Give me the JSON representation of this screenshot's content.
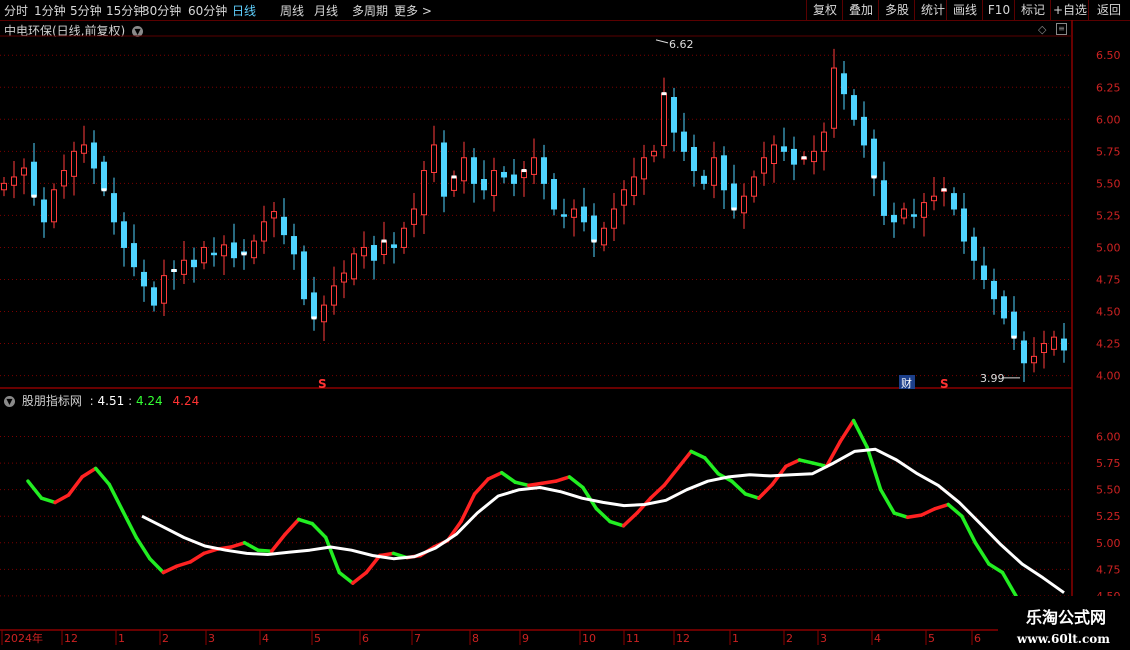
{
  "toolbar": {
    "left_items": [
      "分时",
      "1分钟",
      "5分钟",
      "15分钟",
      "30分钟",
      "60分钟",
      "日线",
      "周线",
      "月线",
      "多周期",
      "更多 >"
    ],
    "active": "日线",
    "right_items": [
      "复权",
      "叠加",
      "多股",
      "统计",
      "画线",
      "F10",
      "标记",
      "+自选",
      "返回"
    ]
  },
  "main_panel": {
    "title": "中电环保(日线,前复权)",
    "high_label": "6.62",
    "low_label": "3.99",
    "event_marks": [
      "S",
      "S"
    ],
    "caibao_mark": "财",
    "price_axis": [
      "6.50",
      "6.25",
      "6.00",
      "5.75",
      "5.50",
      "5.25",
      "5.00",
      "4.75",
      "4.50",
      "4.25",
      "4.00"
    ]
  },
  "indicator": {
    "name": "股朋指标网",
    "sep": ":",
    "value1": "4.51",
    "value2": "4.24",
    "value3": "4.24",
    "axis": [
      "6.00",
      "5.75",
      "5.50",
      "5.25",
      "5.00",
      "4.75",
      "4.50"
    ]
  },
  "time_axis": [
    "2024年",
    "12",
    "1",
    "2",
    "3",
    "4",
    "5",
    "6",
    "7",
    "8",
    "9",
    "10",
    "11",
    "12",
    "1",
    "2",
    "3",
    "4",
    "5",
    "6"
  ],
  "watermark": {
    "name": "乐淘公式网",
    "url": "www.60lt.com"
  },
  "chart_data": {
    "type": "candlestick",
    "ylim": [
      3.95,
      6.65
    ],
    "high": 6.62,
    "low": 3.99,
    "closes": [
      5.5,
      5.55,
      5.62,
      5.4,
      5.2,
      5.45,
      5.6,
      5.75,
      5.8,
      5.62,
      5.45,
      5.2,
      5.0,
      4.85,
      4.7,
      4.55,
      4.78,
      4.82,
      4.9,
      4.85,
      5.0,
      4.95,
      5.02,
      4.92,
      4.95,
      5.05,
      5.2,
      5.28,
      5.1,
      4.95,
      4.6,
      4.45,
      4.55,
      4.7,
      4.8,
      4.95,
      5.0,
      4.9,
      5.05,
      5.0,
      5.15,
      5.3,
      5.6,
      5.8,
      5.4,
      5.55,
      5.7,
      5.5,
      5.45,
      5.6,
      5.55,
      5.5,
      5.6,
      5.7,
      5.5,
      5.3,
      5.25,
      5.3,
      5.2,
      5.05,
      5.15,
      5.3,
      5.45,
      5.55,
      5.7,
      5.75,
      6.2,
      5.9,
      5.75,
      5.6,
      5.5,
      5.7,
      5.45,
      5.3,
      5.4,
      5.55,
      5.7,
      5.8,
      5.75,
      5.65,
      5.7,
      5.75,
      5.9,
      6.4,
      6.2,
      6.0,
      5.8,
      5.55,
      5.25,
      5.2,
      5.3,
      5.25,
      5.35,
      5.4,
      5.45,
      5.3,
      5.05,
      4.9,
      4.75,
      4.6,
      4.45,
      4.3,
      4.1,
      4.15,
      4.25,
      4.3,
      4.2
    ],
    "indicator_line": [
      5.58,
      5.42,
      5.38,
      5.45,
      5.62,
      5.7,
      5.55,
      5.3,
      5.05,
      4.85,
      4.72,
      4.78,
      4.82,
      4.9,
      4.94,
      4.96,
      5.0,
      4.93,
      4.92,
      5.08,
      5.22,
      5.18,
      5.05,
      4.72,
      4.62,
      4.72,
      4.88,
      4.9,
      4.86,
      4.88,
      4.96,
      5.02,
      5.2,
      5.46,
      5.6,
      5.66,
      5.57,
      5.54,
      5.56,
      5.58,
      5.62,
      5.52,
      5.32,
      5.2,
      5.16,
      5.28,
      5.42,
      5.54,
      5.7,
      5.86,
      5.8,
      5.65,
      5.58,
      5.46,
      5.42,
      5.55,
      5.72,
      5.78,
      5.75,
      5.72,
      5.95,
      6.15,
      5.9,
      5.5,
      5.28,
      5.24,
      5.26,
      5.32,
      5.36,
      5.25,
      5.0,
      4.8,
      4.72,
      4.5
    ],
    "ma_line": [
      5.25,
      5.15,
      5.05,
      4.97,
      4.93,
      4.9,
      4.89,
      4.91,
      4.93,
      4.96,
      4.93,
      4.88,
      4.85,
      4.87,
      4.95,
      5.08,
      5.28,
      5.44,
      5.5,
      5.52,
      5.48,
      5.42,
      5.38,
      5.35,
      5.36,
      5.4,
      5.5,
      5.58,
      5.62,
      5.64,
      5.63,
      5.64,
      5.65,
      5.75,
      5.86,
      5.88,
      5.78,
      5.65,
      5.54,
      5.38,
      5.18,
      4.98,
      4.8,
      4.67,
      4.53
    ],
    "indicator_ylim": [
      4.48,
      6.25
    ]
  }
}
